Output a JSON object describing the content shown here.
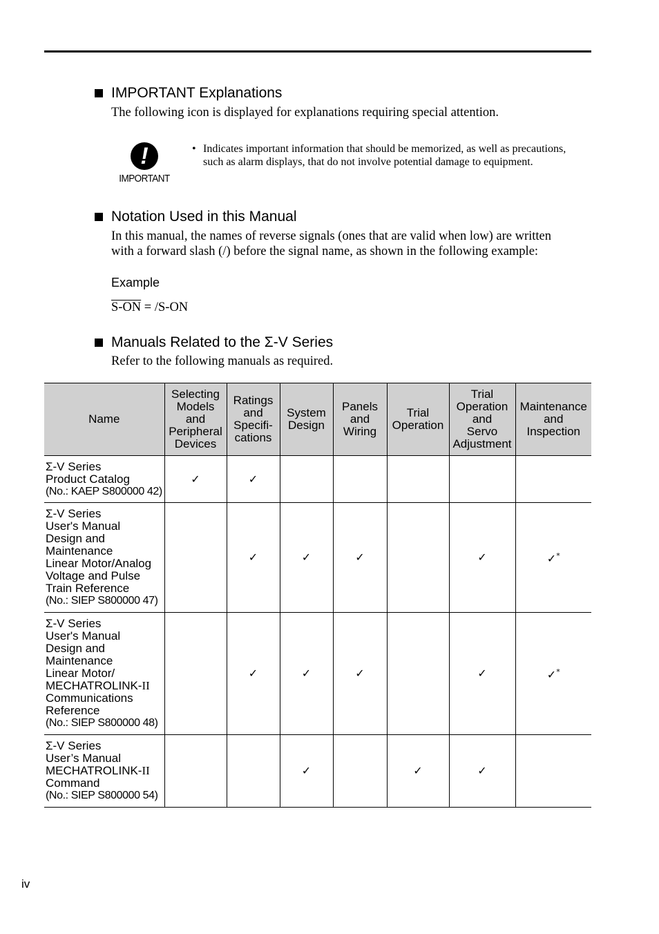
{
  "sections": {
    "important": {
      "heading": "IMPORTANT Explanations",
      "intro": "The following icon is displayed for explanations requiring special attention.",
      "icon_label": "IMPORTANT",
      "icon_glyph": "!",
      "bullet": "•",
      "bullet_text": "Indicates important information that should be memorized, as well as precautions, such as alarm displays, that do not involve potential damage to equipment."
    },
    "notation": {
      "heading": "Notation Used in this Manual",
      "intro_line1": "In this manual, the names of reverse signals (ones that are valid when low) are written",
      "intro_line2": "with a forward slash (/) before the signal name, as shown in the following example:",
      "example_label": "Example",
      "example_signal": "S-ON",
      "example_rest": " = /S-ON"
    },
    "manuals": {
      "heading": "Manuals Related to the Σ-V Series",
      "intro": "Refer to the following manuals as required."
    }
  },
  "table": {
    "headers": [
      [
        "Name"
      ],
      [
        "Selecting",
        "Models",
        "and",
        "Peripheral",
        "Devices"
      ],
      [
        "Ratings",
        "and",
        "Specifi-",
        "cations"
      ],
      [
        "System",
        "Design"
      ],
      [
        "Panels",
        "and",
        "Wiring"
      ],
      [
        "Trial",
        "Operation"
      ],
      [
        "Trial",
        "Operation",
        "and",
        "Servo",
        "Adjustment"
      ],
      [
        "Maintenance",
        "and",
        "Inspection"
      ]
    ],
    "check_glyph": "✓",
    "footnote_mark": "*",
    "rows": [
      {
        "name_lines": [
          "Σ-V Series",
          "Product Catalog"
        ],
        "number": "(No.: KAEP S800000 42)",
        "checks": [
          "✓",
          "✓",
          "",
          "",
          "",
          "",
          ""
        ],
        "marks": [
          "",
          "",
          "",
          "",
          "",
          "",
          ""
        ]
      },
      {
        "name_lines": [
          "Σ-V Series",
          "User's Manual",
          "Design and",
          "Maintenance",
          "Linear Motor/Analog",
          "Voltage and Pulse",
          "Train Reference"
        ],
        "number": "(No.: SIEP S800000 47)",
        "checks": [
          "",
          "✓",
          "✓",
          "✓",
          "",
          "✓",
          "✓"
        ],
        "marks": [
          "",
          "",
          "",
          "",
          "",
          "",
          "*"
        ]
      },
      {
        "name_lines": [
          "Σ-V Series",
          "User's Manual",
          "Design and",
          "Maintenance",
          "Linear Motor/",
          "MECHATROLINK-II",
          "Communications",
          "Reference"
        ],
        "number": "(No.: SIEP S800000 48)",
        "checks": [
          "",
          "✓",
          "✓",
          "✓",
          "",
          "✓",
          "✓"
        ],
        "marks": [
          "",
          "",
          "",
          "",
          "",
          "",
          "*"
        ]
      },
      {
        "name_lines": [
          "Σ-V Series",
          "User’s Manual",
          "MECHATROLINK-II",
          "Command"
        ],
        "number": "(No.: SIEP S800000 54)",
        "checks": [
          "",
          "",
          "✓",
          "",
          "✓",
          "✓",
          ""
        ],
        "marks": [
          "",
          "",
          "",
          "",
          "",
          "",
          ""
        ]
      }
    ]
  },
  "footer": {
    "page_number": "iv"
  }
}
